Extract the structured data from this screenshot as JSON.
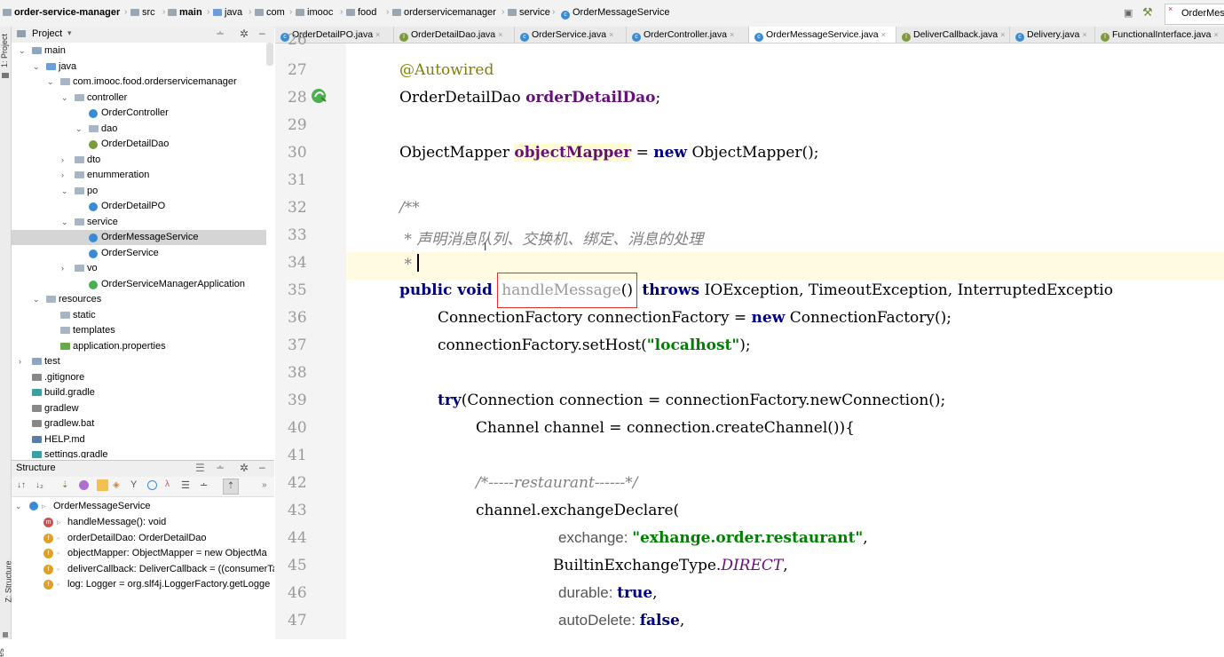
{
  "breadcrumb": {
    "items": [
      "order-service-manager",
      "src",
      "main",
      "java",
      "com",
      "imooc",
      "food",
      "orderservicemanager",
      "service",
      "OrderMessageService"
    ],
    "right_tab": "OrderMes"
  },
  "left_strip": {
    "project_tab": "1: Project",
    "structure_tab": "Z: Structure",
    "bottom_tab": "es"
  },
  "project_panel": {
    "title": "Project",
    "tree": [
      {
        "label": "main",
        "type": "folder-src"
      },
      {
        "label": "java",
        "type": "folder-blue"
      },
      {
        "label": "com.imooc.food.orderservicemanager",
        "type": "package"
      },
      {
        "label": "controller",
        "type": "package"
      },
      {
        "label": "OrderController",
        "type": "class"
      },
      {
        "label": "dao",
        "type": "package"
      },
      {
        "label": "OrderDetailDao",
        "type": "interface"
      },
      {
        "label": "dto",
        "type": "package"
      },
      {
        "label": "enummeration",
        "type": "package"
      },
      {
        "label": "po",
        "type": "package"
      },
      {
        "label": "OrderDetailPO",
        "type": "class"
      },
      {
        "label": "service",
        "type": "package"
      },
      {
        "label": "OrderMessageService",
        "type": "class",
        "selected": true
      },
      {
        "label": "OrderService",
        "type": "class"
      },
      {
        "label": "vo",
        "type": "package"
      },
      {
        "label": "OrderServiceManagerApplication",
        "type": "spring-class"
      },
      {
        "label": "resources",
        "type": "folder-res"
      },
      {
        "label": "static",
        "type": "folder"
      },
      {
        "label": "templates",
        "type": "folder"
      },
      {
        "label": "application.properties",
        "type": "properties"
      },
      {
        "label": "test",
        "type": "folder-src"
      },
      {
        "label": ".gitignore",
        "type": "file"
      },
      {
        "label": "build.gradle",
        "type": "gradle"
      },
      {
        "label": "gradlew",
        "type": "file"
      },
      {
        "label": "gradlew.bat",
        "type": "file"
      },
      {
        "label": "HELP.md",
        "type": "md"
      },
      {
        "label": "settings.gradle",
        "type": "gradle"
      }
    ]
  },
  "structure_panel": {
    "title": "Structure",
    "root": "OrderMessageService",
    "members": [
      {
        "badge": "m",
        "label": "handleMessage(): void",
        "color": "#d05050"
      },
      {
        "badge": "f",
        "label": "orderDetailDao: OrderDetailDao",
        "color": "#e0a020"
      },
      {
        "badge": "f",
        "label": "objectMapper: ObjectMapper = new ObjectMa",
        "color": "#e0a020"
      },
      {
        "badge": "f",
        "label": "deliverCallback: DeliverCallback = ((consumerTa",
        "color": "#e0a020"
      },
      {
        "badge": "f",
        "label": "log: Logger = org.slf4j.LoggerFactory.getLogge",
        "color": "#e0a020"
      }
    ]
  },
  "tabs": [
    {
      "label": "OrderDetailPO.java",
      "icon": "class-icon"
    },
    {
      "label": "OrderDetailDao.java",
      "icon": "interface-icon"
    },
    {
      "label": "OrderService.java",
      "icon": "class-icon"
    },
    {
      "label": "OrderController.java",
      "icon": "class-icon"
    },
    {
      "label": "OrderMessageService.java",
      "icon": "class-icon",
      "active": true
    },
    {
      "label": "DeliverCallback.java",
      "icon": "interface-icon"
    },
    {
      "label": "Delivery.java",
      "icon": "class-icon"
    },
    {
      "label": "FunctionalInterface.java",
      "icon": "annotation-icon"
    }
  ],
  "editor": {
    "lines": [
      "27",
      "28",
      "29",
      "30",
      "31",
      "32",
      "33",
      "34",
      "35",
      "36",
      "37",
      "38",
      "39",
      "40",
      "41",
      "42",
      "43",
      "44",
      "45",
      "46",
      "47"
    ],
    "top_partial_line": "26",
    "code": {
      "l27": "@Autowired",
      "l28_type": "OrderDetailDao ",
      "l28_field": "orderDetailDao",
      "l28_end": ";",
      "l30_type": "ObjectMapper ",
      "l30_field": "objectMapper",
      "l30_mid": " = ",
      "l30_new": "new",
      "l30_end": " ObjectMapper();",
      "l32": "/**",
      "l33": " * 声明消息队列、交换机、绑定、消息的处理",
      "l34": " *",
      "l35_kw": "public void",
      "l35_method": "handleMessage",
      "l35_paren": "()",
      "l35_throws": "throws",
      "l35_rest": " IOException, TimeoutException, InterruptedExceptio",
      "l36_a": "ConnectionFactory connectionFactory = ",
      "l36_new": "new",
      "l36_b": " ConnectionFactory();",
      "l37_a": "connectionFactory.setHost(",
      "l37_str": "\"localhost\"",
      "l37_b": ");",
      "l39_try": "try",
      "l39_rest": "(Connection connection = connectionFactory.newConnection();",
      "l40": "Channel channel = connection.createChannel()){",
      "l42": "/*-----restaurant------*/",
      "l43": "channel.exchangeDeclare(",
      "l44_hint": "exchange: ",
      "l44_str": "\"exhange.order.restaurant\"",
      "l44_end": ",",
      "l45_a": "BuiltinExchangeType.",
      "l45_const": "DIRECT",
      "l45_end": ",",
      "l46_hint": "durable: ",
      "l46_val": "true",
      "l46_end": ",",
      "l47_hint": "autoDelete: ",
      "l47_val": "false",
      "l47_end": ","
    }
  },
  "colors": {
    "keyword": "#000080",
    "annotation": "#808000",
    "field": "#660e7a",
    "string": "#008000",
    "comment": "#808080",
    "highlight_box": "#e03030",
    "field_highlight": "#fffbd0"
  }
}
